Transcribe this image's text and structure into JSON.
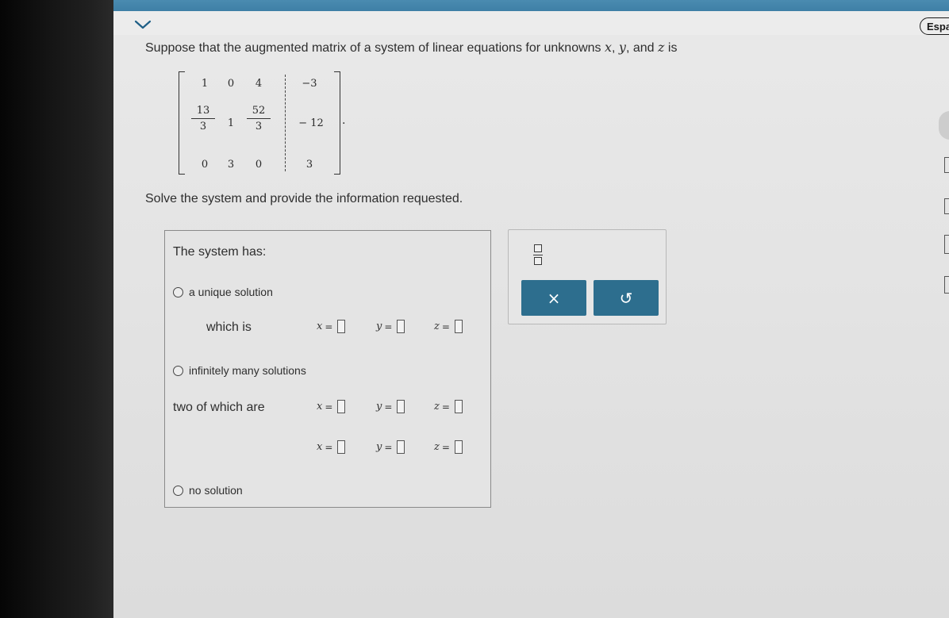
{
  "header": {
    "language_button": "Espa"
  },
  "question": {
    "prefix": "Suppose that the augmented matrix of a system of linear equations for unknowns ",
    "var_x": "x",
    "comma1": ", ",
    "var_y": "y",
    "and_text": ", and ",
    "var_z": "z",
    "suffix": " is"
  },
  "matrix": {
    "r1": [
      "1",
      "0",
      "4",
      "−3"
    ],
    "r2": {
      "c1_num": "13",
      "c1_den": "3",
      "c2": "1",
      "c3_num": "52",
      "c3_den": "3",
      "c4": "− 12"
    },
    "r3": [
      "0",
      "3",
      "0",
      "3"
    ],
    "period": "."
  },
  "instruction": "Solve the system and provide the information requested.",
  "answer": {
    "title": "The system has:",
    "option_unique": "a unique solution",
    "which_is": "which is",
    "option_infinite": "infinitely many solutions",
    "two_of_which": "two of which are",
    "option_none": "no solution",
    "var_x": "x",
    "var_y": "y",
    "var_z": "z",
    "equals": "="
  },
  "toolbox": {
    "clear_symbol": "×",
    "undo_symbol": "↺"
  },
  "colors": {
    "accent": "#2d6e8e",
    "top_bar": "#4a8bb0"
  },
  "icons": {
    "dropdown": "chevron-down-icon",
    "fraction": "fraction-template-icon",
    "clear": "close-icon",
    "undo": "undo-icon"
  }
}
